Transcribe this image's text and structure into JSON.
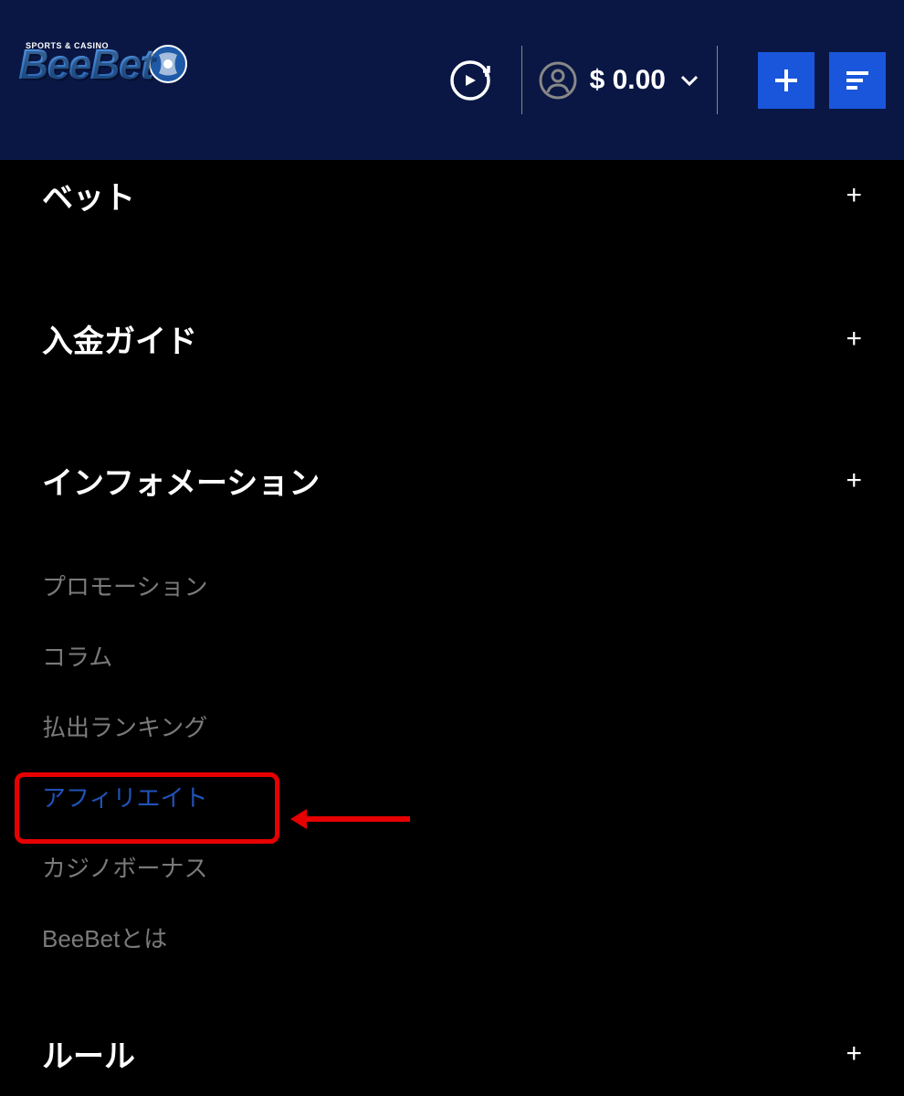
{
  "header": {
    "logo_main": "BeeBet",
    "logo_sub": "SPORTS & CASINO",
    "balance": "$ 0.00"
  },
  "menu": {
    "bet": {
      "title": "ベット",
      "expand": "+"
    },
    "deposit": {
      "title": "入金ガイド",
      "expand": "+"
    },
    "information": {
      "title": "インフォメーション",
      "expand": "+",
      "items": [
        "プロモーション",
        "コラム",
        "払出ランキング",
        "アフィリエイト",
        "カジノボーナス",
        "BeeBetとは"
      ]
    },
    "rules": {
      "title": "ルール",
      "expand": "+"
    }
  }
}
